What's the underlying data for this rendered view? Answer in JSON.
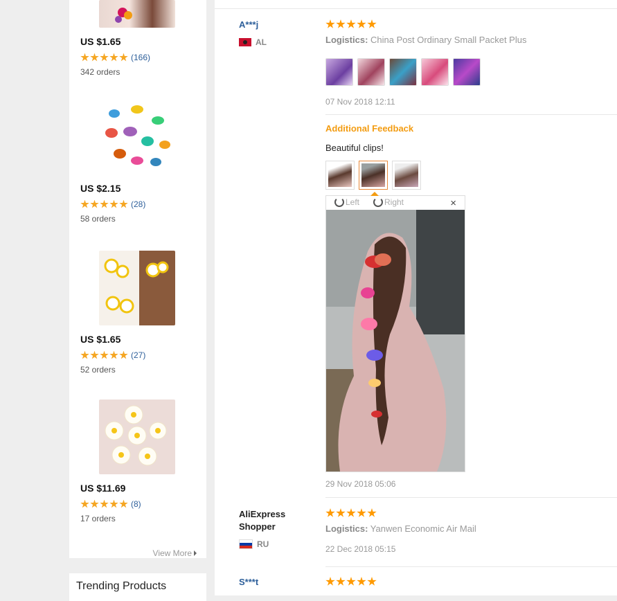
{
  "sidebar": {
    "products": [
      {
        "price": "US $1.65",
        "rating_count": "(166)",
        "orders": "342 orders"
      },
      {
        "price": "US $2.15",
        "rating_count": "(28)",
        "orders": "58 orders"
      },
      {
        "price": "US $1.65",
        "rating_count": "(27)",
        "orders": "52 orders"
      },
      {
        "price": "US $11.69",
        "rating_count": "(8)",
        "orders": "17 orders"
      }
    ],
    "view_more": "View More",
    "trending_title": "Trending Products"
  },
  "reviews": [
    {
      "user": "A***j",
      "country": "AL",
      "logistics_label": "Logistics:",
      "logistics": "China Post Ordinary Small Packet Plus",
      "date": "07 Nov 2018 12:11"
    },
    {
      "user": "AliExpress Shopper",
      "country": "RU",
      "logistics_label": "Logistics:",
      "logistics": "Yanwen Economic Air Mail",
      "date": "22 Dec 2018 05:15"
    },
    {
      "user": "S***t"
    }
  ],
  "additional_feedback": {
    "title": "Additional Feedback",
    "text": "Beautiful clips!",
    "date": "29 Nov 2018 05:06",
    "rotate_left": "Left",
    "rotate_right": "Right",
    "close": "×"
  },
  "colors": {
    "accent": "#f39c12",
    "link": "#2d5f9a",
    "star": "#ff9a00"
  }
}
